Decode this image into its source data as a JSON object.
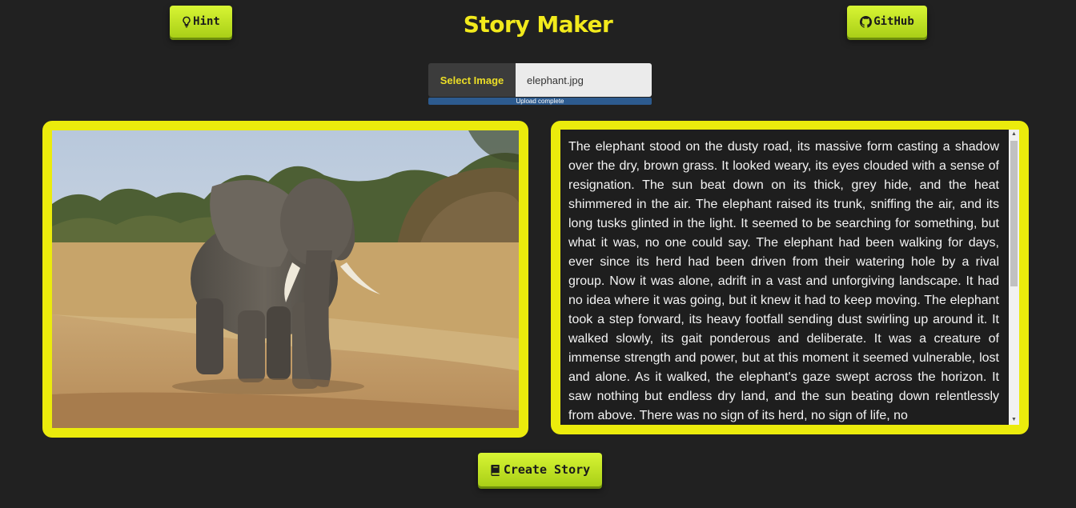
{
  "header": {
    "title": "Story Maker",
    "hint_label": "Hint",
    "github_label": "GitHub"
  },
  "upload": {
    "select_label": "Select Image",
    "filename": "elephant.jpg",
    "status": "Upload complete",
    "progress": 1.0
  },
  "image": {
    "alt": "elephant.jpg"
  },
  "story": {
    "text": "The elephant stood on the dusty road, its massive form casting a shadow over the dry, brown grass. It looked weary, its eyes clouded with a sense of resignation. The sun beat down on its thick, grey hide, and the heat shimmered in the air. The elephant raised its trunk, sniffing the air, and its long tusks glinted in the light. It seemed to be searching for something, but what it was, no one could say. The elephant had been walking for days, ever since its herd had been driven from their watering hole by a rival group. Now it was alone, adrift in a vast and unforgiving landscape. It had no idea where it was going, but it knew it had to keep moving. The elephant took a step forward, its heavy footfall sending dust swirling up around it. It walked slowly, its gait ponderous and deliberate. It was a creature of immense strength and power, but at this moment it seemed vulnerable, lost and alone. As it walked, the elephant's gaze swept across the horizon. It saw nothing but endless dry land, and the sun beating down relentlessly from above. There was no sign of its herd, no sign of life, no"
  },
  "footer": {
    "create_label": "Create Story"
  },
  "icons": {
    "hint": "lightbulb-icon",
    "github": "github-icon",
    "create": "book-icon"
  },
  "colors": {
    "background": "#212121",
    "accent": "#ebeb0c",
    "title": "#f2ea1c",
    "button": "#c5e325"
  }
}
